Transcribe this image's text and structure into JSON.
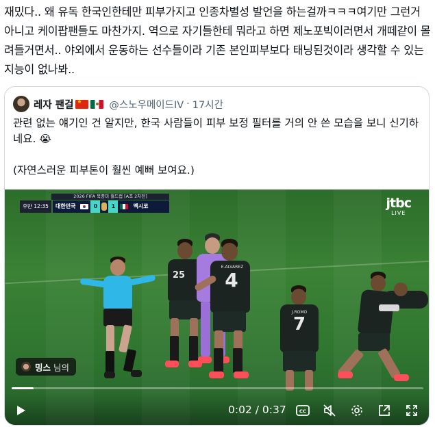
{
  "post": {
    "text": "재밌다.. 왜 유독 한국인한테만 피부가지고 인종차별성 발언을 하는걸까ㅋㅋㅋ여기만 그런거 아니고 케이팝팬들도 마찬가지. 역으로 자기들한테 뭐라고 하면 제노포빅이러면서 개떼같이 몰려들거면서..  야외에서 운동하는 선수들이라 기존 본인피부보다 태닝된것이라 생각할 수 있는 지능이 없나봐.."
  },
  "quote": {
    "author_name": "레자 팬걸",
    "handle": "@스노우메이드IV",
    "separator": "·",
    "time": "17시간",
    "text_line1": "관련 없는 얘기인 건 알지만, 한국 사람들이 피부 보정 필터를 거의 안 쓴 모습을 보니 신기하네요.",
    "emoji": "😭",
    "text_line2": "(자연스러운 피부톤이 훨씬 예뻐 보여요.)"
  },
  "video": {
    "scorebug": {
      "tournament": "2026 FIFA 북중미 월드컵 [A조 2차전]",
      "period": "후반",
      "clock": "12:35",
      "home_team": "대한민국",
      "home_score": "0",
      "away_score": "1",
      "away_team": "멕시코"
    },
    "broadcaster": "jtbc",
    "broadcaster_live": "LIVE",
    "player_numbers": [
      "25",
      "4",
      "7"
    ],
    "player_names": [
      "E.ALVAREZ",
      "J.ROMO"
    ],
    "sponsor_name": "밍스",
    "sponsor_suffix": "님의",
    "time_readout": "0:02 / 0:37",
    "progress": 0.054
  },
  "icons": {
    "play": "play-icon",
    "cc": "closed-captions-icon",
    "mute": "muted-speaker-icon",
    "settings": "gear-icon",
    "popout": "popout-icon",
    "fullscreen": "fullscreen-icon"
  },
  "colors": {
    "text": "#0f1419",
    "muted": "#536471",
    "border": "#cfd9de",
    "score_accent": "#47d7c8"
  }
}
